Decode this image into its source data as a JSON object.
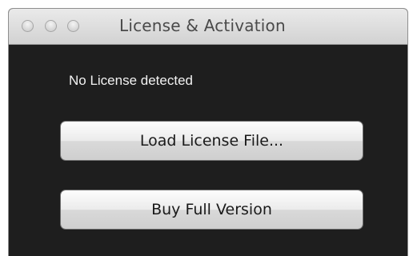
{
  "window": {
    "title": "License & Activation"
  },
  "status": {
    "message": "No License detected"
  },
  "buttons": {
    "load_license_label": "Load License File...",
    "buy_full_label": "Buy Full Version"
  },
  "colors": {
    "window_background": "#1e1e1e",
    "titlebar_top": "#eaeaea",
    "titlebar_bottom": "#d2d2d2",
    "status_text": "#f2f2f2",
    "button_text": "#1a1a1a"
  }
}
